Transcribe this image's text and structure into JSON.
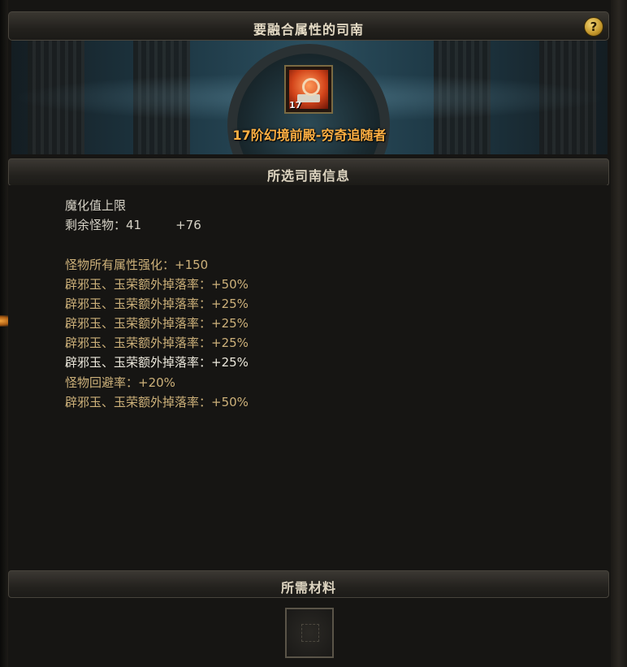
{
  "window": {
    "title": "要融合属性的司南",
    "help_label": "?"
  },
  "selected_item": {
    "level": "17",
    "name": "17阶幻境前殿-穷奇追随者"
  },
  "info_section": {
    "title": "所选司南信息",
    "lines": [
      {
        "label": "魔化值上限",
        "value": ""
      },
      {
        "label": "剩余怪物：41",
        "value": "+76"
      },
      {
        "label": "怪物所有属性强化：+150",
        "value": ""
      },
      {
        "label": "辟邪玉、玉荣额外掉落率：+50%",
        "value": ""
      },
      {
        "label": "辟邪玉、玉荣额外掉落率：+25%",
        "value": ""
      },
      {
        "label": "辟邪玉、玉荣额外掉落率：+25%",
        "value": ""
      },
      {
        "label": "辟邪玉、玉荣额外掉落率：+25%",
        "value": ""
      },
      {
        "label": "辟邪玉、玉荣额外掉落率：+25%",
        "value": ""
      },
      {
        "label": "怪物回避率：+20%",
        "value": ""
      },
      {
        "label": "辟邪玉、玉荣额外掉落率：+50%",
        "value": ""
      }
    ]
  },
  "materials_section": {
    "title": "所需材料"
  },
  "colors": {
    "item_name": "#ffb043",
    "attribute_text": "#cdb17a",
    "plain_text": "#d6d2c6",
    "help_button": "#d7a93a"
  }
}
